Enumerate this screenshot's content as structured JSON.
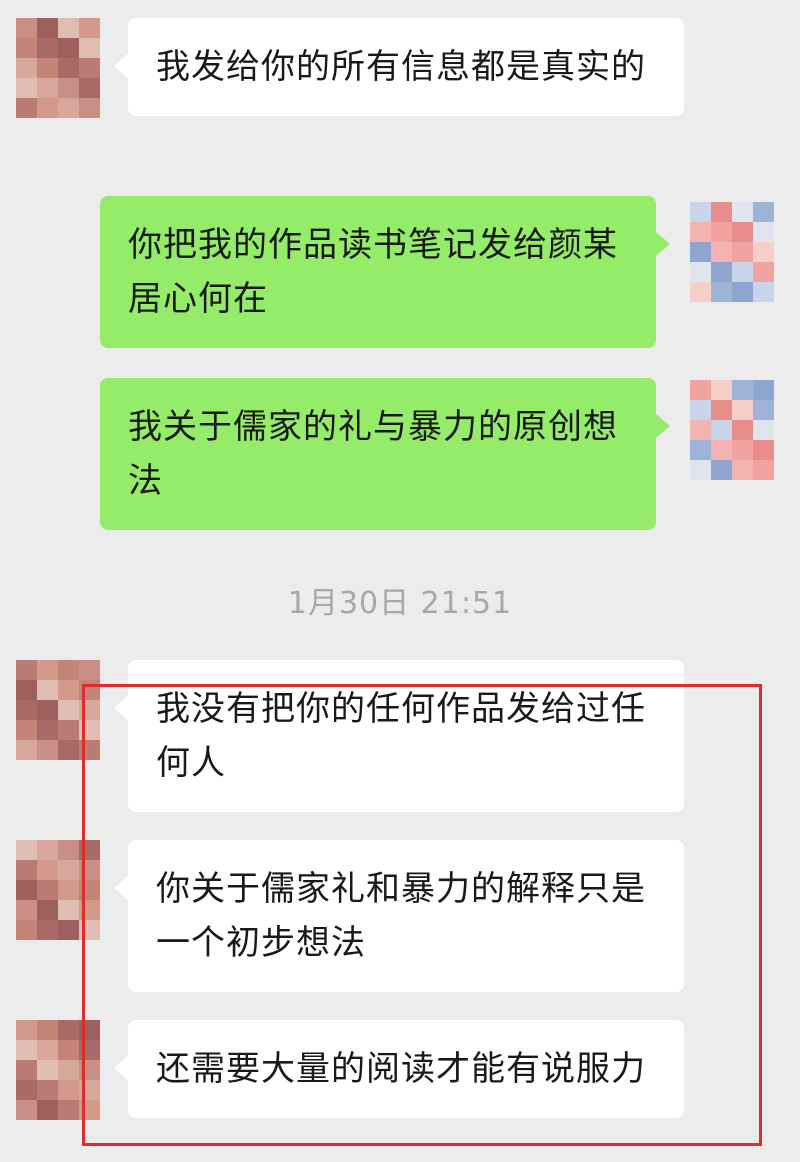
{
  "messages": [
    {
      "side": "in",
      "text": "我发给你的所有信息都是真实的"
    },
    {
      "side": "out",
      "text": "你把我的作品读书笔记发给颜某居心何在"
    },
    {
      "side": "out",
      "text": "我关于儒家的礼与暴力的原创想法"
    },
    {
      "side": "in",
      "text": "我没有把你的任何作品发给过任何人"
    },
    {
      "side": "in",
      "text": "你关于儒家礼和暴力的解释只是一个初步想法"
    },
    {
      "side": "in",
      "text": "还需要大量的阅读才能有说服力"
    }
  ],
  "timestamp": "1月30日 21:51",
  "colors": {
    "background": "#ececec",
    "incoming_bubble": "#ffffff",
    "outgoing_bubble": "#95ec69",
    "highlight_box": "#e02b2b"
  }
}
